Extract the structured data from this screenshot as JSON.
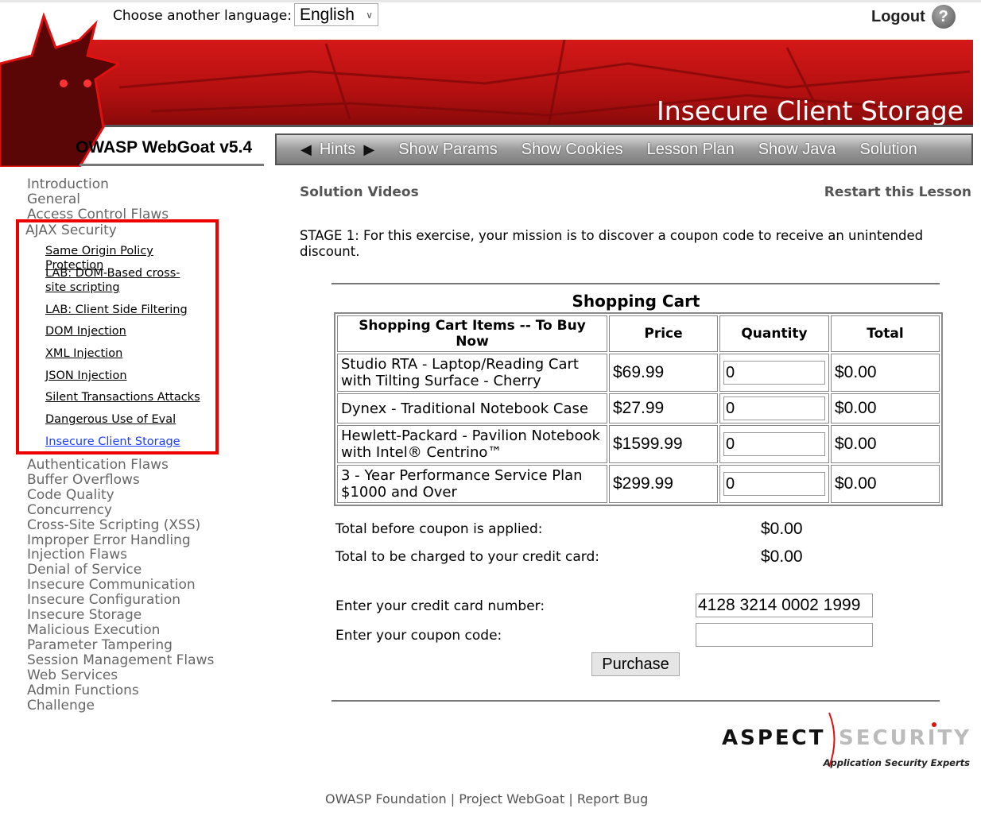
{
  "header": {
    "language_label": "Choose another language:",
    "language_value": "English",
    "logout": "Logout",
    "help_icon": "?",
    "brand": "OWASP WebGoat  v5.4",
    "banner_title": "Insecure Client Storage"
  },
  "nav": {
    "items": [
      "Hints",
      "Show Params",
      "Show Cookies",
      "Lesson Plan",
      "Show Java",
      "Solution"
    ]
  },
  "sidebar": {
    "top": [
      "Introduction",
      "General",
      "Access Control Flaws"
    ],
    "active_category": "AJAX Security",
    "lessons": [
      "Same Origin Policy Protection",
      "LAB: DOM-Based cross-site scripting",
      "LAB: Client Side Filtering",
      "DOM Injection",
      "XML Injection",
      "JSON Injection",
      "Silent Transactions Attacks",
      "Dangerous Use of Eval",
      "Insecure Client Storage"
    ],
    "bottom": [
      "Authentication Flaws",
      "Buffer Overflows",
      "Code Quality",
      "Concurrency",
      "Cross-Site Scripting (XSS)",
      "Improper Error Handling",
      "Injection Flaws",
      "Denial of Service",
      "Insecure Communication",
      "Insecure Configuration",
      "Insecure Storage",
      "Malicious Execution",
      "Parameter Tampering",
      "Session Management Flaws",
      "Web Services",
      "Admin Functions",
      "Challenge"
    ]
  },
  "main": {
    "solution_videos": "Solution Videos",
    "restart": "Restart this Lesson",
    "stage": "STAGE 1: For this exercise, your mission is to discover a coupon code to receive an unintended discount.",
    "cart_title": "Shopping Cart",
    "columns": [
      "Shopping Cart Items -- To Buy Now",
      "Price",
      "Quantity",
      "Total"
    ],
    "rows": [
      {
        "item": "Studio RTA - Laptop/Reading Cart with Tilting Surface - Cherry",
        "price": "$69.99",
        "qty": "0",
        "total": "$0.00"
      },
      {
        "item": "Dynex - Traditional Notebook Case",
        "price": "$27.99",
        "qty": "0",
        "total": "$0.00"
      },
      {
        "item": "Hewlett-Packard - Pavilion Notebook with Intel® Centrino™",
        "price": "$1599.99",
        "qty": "0",
        "total": "$0.00"
      },
      {
        "item": "3 - Year Performance Service Plan $1000 and Over",
        "price": "$299.99",
        "qty": "0",
        "total": "$0.00"
      }
    ],
    "before_coupon_label": "Total before coupon is applied:",
    "before_coupon_value": "$0.00",
    "charged_label": "Total to be charged to your credit card:",
    "charged_value": "$0.00",
    "cc_label": "Enter your credit card number:",
    "cc_value": "4128 3214 0002 1999",
    "coupon_label": "Enter your coupon code:",
    "coupon_value": "",
    "purchase": "Purchase"
  },
  "logo": {
    "word1": "ASPECT",
    "word2": "SECURITY",
    "tagline": "Application Security Experts"
  },
  "footer": {
    "links": [
      "OWASP Foundation",
      "Project WebGoat",
      "Report Bug"
    ],
    "sep": "|"
  }
}
